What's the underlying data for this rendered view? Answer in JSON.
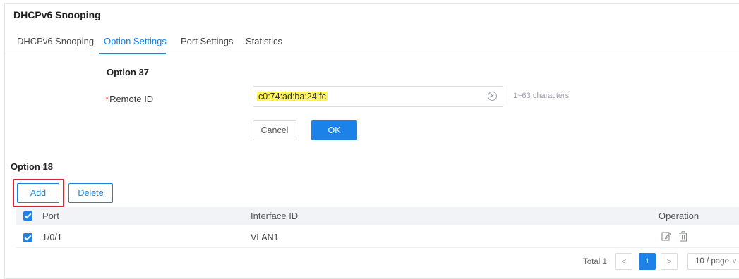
{
  "page": {
    "title": "DHCPv6 Snooping"
  },
  "tabs": [
    {
      "label": "DHCPv6 Snooping",
      "active": false
    },
    {
      "label": "Option Settings",
      "active": true
    },
    {
      "label": "Port Settings",
      "active": false
    },
    {
      "label": "Statistics",
      "active": false
    }
  ],
  "option37": {
    "title": "Option 37",
    "remote_id_label": "Remote ID",
    "remote_id_value": "c0:74:ad:ba:24:fc",
    "remote_id_hint": "1~63 characters",
    "required_mark": "*",
    "cancel_label": "Cancel",
    "ok_label": "OK"
  },
  "option18": {
    "title": "Option 18",
    "add_label": "Add",
    "delete_label": "Delete",
    "columns": [
      "Port",
      "Interface ID",
      "Operation"
    ],
    "rows": [
      {
        "port": "1/0/1",
        "interface_id": "VLAN1",
        "checked": true
      }
    ]
  },
  "pagination": {
    "total_text": "Total 1",
    "prev_symbol": "<",
    "current_page": "1",
    "next_symbol": ">",
    "page_size": "10 / page",
    "page_size_chevron": "∨"
  },
  "colors": {
    "accent": "#1a82e8",
    "highlight_box": "#d9252f",
    "value_highlight": "#fff35a",
    "required": "#e8574a"
  },
  "icons": {
    "clear": "clear-circle-icon",
    "edit": "edit-icon",
    "delete": "trash-icon"
  }
}
